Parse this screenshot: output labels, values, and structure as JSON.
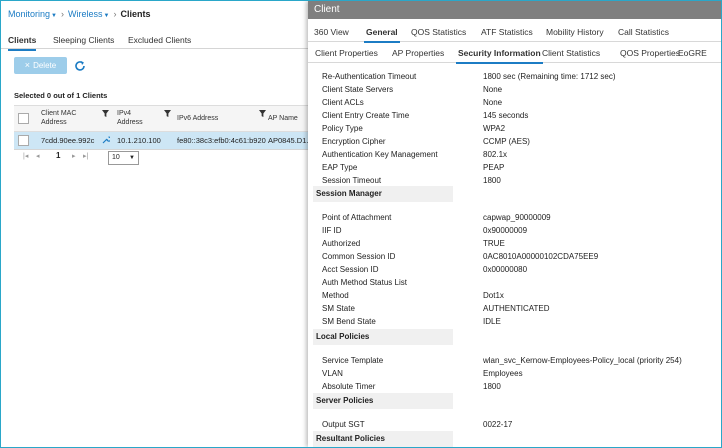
{
  "breadcrumb": {
    "monitoring": "Monitoring",
    "wireless": "Wireless",
    "current": "Clients",
    "caret": "▼",
    "sep": "›"
  },
  "left_tabs": [
    "Clients",
    "Sleeping Clients",
    "Excluded Clients"
  ],
  "toolbar": {
    "delete_label": "Delete",
    "delete_icon": "×"
  },
  "selection": "Selected 0 out of 1 Clients",
  "table": {
    "headers": {
      "mac": "Client MAC\nAddress",
      "ipv4": "IPv4\nAddress",
      "ipv6": "IPv6 Address",
      "ap": "AP Name"
    },
    "row": {
      "mac": "7cdd.90ee.992c",
      "ipv4": "10.1.210.100",
      "ipv6": "fe80::38c3:efb0:4c61:b920",
      "ap": "AP0845.D1..."
    }
  },
  "pager": {
    "first": "|◂",
    "prev": "◂",
    "page": "1",
    "next": "▸",
    "last": "▸|",
    "per_page": "10",
    "dd": "▼"
  },
  "panel": {
    "title": "Client",
    "tabs": [
      "360 View",
      "General",
      "QOS Statistics",
      "ATF Statistics",
      "Mobility History",
      "Call Statistics"
    ],
    "subtabs": [
      "Client Properties",
      "AP Properties",
      "Security Information",
      "Client Statistics",
      "QOS Properties",
      "EoGRE"
    ],
    "security": [
      {
        "label": "Re-Authentication Timeout",
        "value": "1800 sec (Remaining time: 1712 sec)"
      },
      {
        "label": "Client State Servers",
        "value": "None"
      },
      {
        "label": "Client ACLs",
        "value": "None"
      },
      {
        "label": "Client Entry Create Time",
        "value": "145 seconds"
      },
      {
        "label": "Policy Type",
        "value": "WPA2"
      },
      {
        "label": "Encryption Cipher",
        "value": "CCMP (AES)"
      },
      {
        "label": "Authentication Key Management",
        "value": "802.1x"
      },
      {
        "label": "EAP Type",
        "value": "PEAP"
      },
      {
        "label": "Session Timeout",
        "value": "1800"
      }
    ],
    "session_manager_title": "Session Manager",
    "session_manager": [
      {
        "label": "Point of Attachment",
        "value": "capwap_90000009"
      },
      {
        "label": "IIF ID",
        "value": "0x90000009"
      },
      {
        "label": "Authorized",
        "value": "TRUE"
      },
      {
        "label": "Common Session ID",
        "value": "0AC8010A00000102CDA75EE9"
      },
      {
        "label": "Acct Session ID",
        "value": "0x00000080"
      },
      {
        "label": "Auth Method Status List",
        "value": ""
      },
      {
        "label": "Method",
        "value": "Dot1x"
      },
      {
        "label": "SM State",
        "value": "AUTHENTICATED"
      },
      {
        "label": "SM Bend State",
        "value": "IDLE"
      }
    ],
    "local_policies_title": "Local Policies",
    "local_policies": [
      {
        "label": "Service Template",
        "value": "wlan_svc_Kernow-Employees-Policy_local (priority 254)"
      },
      {
        "label": "VLAN",
        "value": "Employees"
      },
      {
        "label": "Absolute Timer",
        "value": "1800"
      }
    ],
    "server_policies_title": "Server Policies",
    "server_policies": [
      {
        "label": "Output SGT",
        "value": "0022-17"
      }
    ],
    "resultant_policies_title": "Resultant Policies"
  },
  "colors": {
    "accent": "#1c7cc4",
    "frame": "#2aa7c9",
    "selected_row": "#cde6f5",
    "panel_title": "#7f7f7f"
  },
  "icons": {
    "refresh": "refresh-icon",
    "filter": "filter-icon",
    "wrench": "wrench-icon"
  }
}
